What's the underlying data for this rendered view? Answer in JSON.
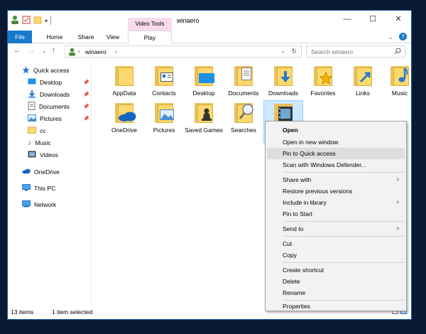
{
  "window": {
    "title": "winaero",
    "contextual_group": "Video Tools",
    "controls": {
      "minimize": "—",
      "maximize": "☐",
      "close": "✕"
    }
  },
  "ribbon": {
    "tabs": [
      "File",
      "Home",
      "Share",
      "View",
      "Play"
    ]
  },
  "address": {
    "crumb": "winaero",
    "search_placeholder": "Search winaero"
  },
  "nav": {
    "items": [
      {
        "label": "Quick access",
        "icon": "star-icon",
        "pinned": false
      },
      {
        "label": "Desktop",
        "icon": "desktop-icon",
        "pinned": true
      },
      {
        "label": "Downloads",
        "icon": "download-icon",
        "pinned": true
      },
      {
        "label": "Documents",
        "icon": "document-icon",
        "pinned": true
      },
      {
        "label": "Pictures",
        "icon": "pictures-icon",
        "pinned": true
      },
      {
        "label": "cc",
        "icon": "folder-icon",
        "pinned": false
      },
      {
        "label": "Music",
        "icon": "music-icon",
        "pinned": false
      },
      {
        "label": "Videos",
        "icon": "video-icon",
        "pinned": false
      },
      {
        "label": "OneDrive",
        "icon": "cloud-icon",
        "pinned": false
      },
      {
        "label": "This PC",
        "icon": "computer-icon",
        "pinned": false
      },
      {
        "label": "Network",
        "icon": "network-icon",
        "pinned": false
      }
    ]
  },
  "folders": [
    {
      "label": "AppData",
      "overlay": ""
    },
    {
      "label": "Contacts",
      "overlay": "contacts"
    },
    {
      "label": "Desktop",
      "overlay": "desktop"
    },
    {
      "label": "Documents",
      "overlay": "documents"
    },
    {
      "label": "Downloads",
      "overlay": "downloads"
    },
    {
      "label": "Favorites",
      "overlay": "favorites"
    },
    {
      "label": "Links",
      "overlay": "links"
    },
    {
      "label": "Music",
      "overlay": "music"
    },
    {
      "label": "OneDrive",
      "overlay": "onedrive"
    },
    {
      "label": "Pictures",
      "overlay": "pictures"
    },
    {
      "label": "Saved Games",
      "overlay": "games"
    },
    {
      "label": "Searches",
      "overlay": "searches"
    },
    {
      "label": "",
      "overlay": "videos"
    }
  ],
  "status": {
    "count": "13 items",
    "selected": "1 item selected"
  },
  "context_menu": {
    "items": [
      "Open",
      "Open in new window",
      "Pin to Quick access",
      "Scan with Windows Defender...",
      "Share with",
      "Restore previous versions",
      "Include in library",
      "Pin to Start",
      "Send to",
      "Cut",
      "Copy",
      "Create shortcut",
      "Delete",
      "Rename",
      "Properties"
    ],
    "highlighted": "Pin to Quick access"
  },
  "colors": {
    "accent": "#1979ca",
    "folder": "#fbd96d",
    "selection": "#cce8ff"
  }
}
